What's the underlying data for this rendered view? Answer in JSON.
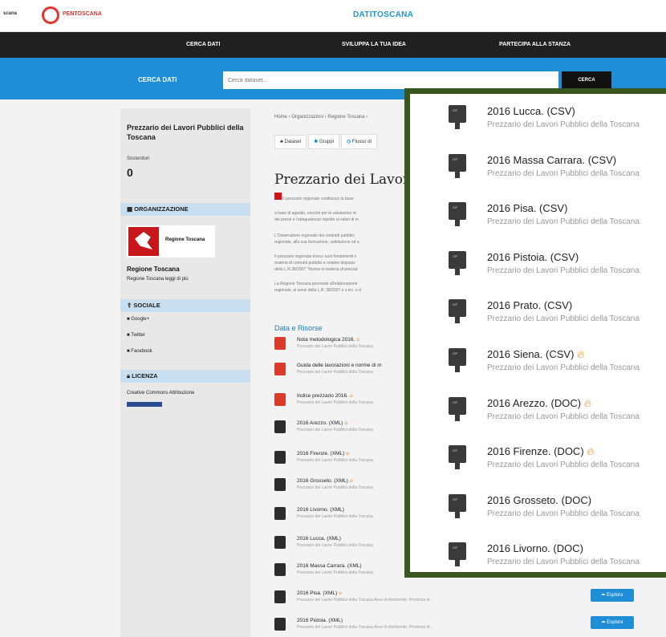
{
  "header": {
    "left_fragment": "scana",
    "logo_text": "PENTOSCANA",
    "site_title": "DATITOSCANA"
  },
  "nav": {
    "items": [
      "CERCA DATI",
      "SVILUPPA LA TUA IDEA",
      "PARTECIPA ALLA STANZA"
    ]
  },
  "search": {
    "label": "CERCA DATI",
    "placeholder": "Cerca dataset...",
    "button": "CERCA"
  },
  "sidebar": {
    "org_title": "Prezzario dei Lavori Pubblici della Toscana",
    "followers_label": "Sostenitori",
    "followers_count": "0",
    "org_section": "ORGANIZZAZIONE",
    "org_logo_text": "Regione Toscana",
    "org_name": "Regione Toscana",
    "org_link": "Regione Toscana leggi di più",
    "social_section": "SOCIALE",
    "social": [
      "Google+",
      "Twitter",
      "Facebook"
    ],
    "license_section": "LICENZA",
    "license_text": "Creative Commons Attribuzione"
  },
  "main": {
    "breadcrumb": "Home › Organizzazioni › Regione Toscana ›",
    "tabs": [
      "Dataset",
      "Gruppi",
      "Flusso di"
    ],
    "title": "Prezzario dei Lavori",
    "paragraphs": [
      "Il prezzario regionale costituisce la base",
      "a base di appalto, nonché per le valutazioni re",
      "dei prezzi e l'adeguatezza rispetto ai valori di m",
      "L'Osservatorio regionale dei contratti pubblici",
      "regionale, alla sua formazione, validazione ed a",
      "Il prezzario regionale trova i suoi fondamenti n",
      "materia di contratti pubblici e relative disposiz",
      "della L.R.38/2007 \"Norme in materia di prezzar",
      "La Regione Toscana provvede all'elaborazione",
      "regionale, ai sensi della L.R. 38/2007 e s.m.i. e d"
    ],
    "resources_heading": "Data e Risorse",
    "resources": [
      {
        "title": "Nota metodologica 2016.",
        "desc": "Prezzario dei Lavori Pubblici della Toscana",
        "type": "pdf",
        "hot": true
      },
      {
        "title": "Guida delle lavorazioni e norme di m",
        "desc": "Prezzario dei Lavori Pubblici della Toscana",
        "type": "pdf",
        "hot": false
      },
      {
        "title": "Indice prezzario 2016.",
        "desc": "Prezzario dei Lavori Pubblici della Toscana",
        "type": "pdf",
        "hot": true
      },
      {
        "title": "2016 Arezzo. (XML)",
        "desc": "Prezzario dei Lavori Pubblici della Toscana",
        "type": "zip",
        "hot": true
      },
      {
        "title": "2016 Firenze. (XML)",
        "desc": "Prezzario dei Lavori Pubblici della Toscana",
        "type": "zip",
        "hot": true
      },
      {
        "title": "2016 Grosseto. (XML)",
        "desc": "Prezzario dei Lavori Pubblici della Toscana",
        "type": "zip",
        "hot": true
      },
      {
        "title": "2016 Livorno. (XML)",
        "desc": "Prezzario dei Lavori Pubblici della Toscana",
        "type": "zip",
        "hot": false
      },
      {
        "title": "2016 Lucca. (XML)",
        "desc": "Prezzario dei Lavori Pubblici della Toscana",
        "type": "zip",
        "hot": false
      },
      {
        "title": "2016 Massa Carrara. (XML)",
        "desc": "Prezzario dei Lavori Pubblici della Toscana",
        "type": "zip",
        "hot": false
      },
      {
        "title": "2016 Pisa. (XML)",
        "desc": "Prezzario dei Lavori Pubblici della Toscana Area di riferimento: Provincia di...",
        "type": "zip",
        "hot": true
      },
      {
        "title": "2016 Pistoia. (XML)",
        "desc": "Prezzario dei Lavori Pubblici della Toscana Area di riferimento: Provincia di...",
        "type": "zip",
        "hot": false
      }
    ],
    "explore_label": "Esplora"
  },
  "zoom": {
    "items": [
      {
        "title": "2016 Lucca. (CSV)",
        "desc": "Prezzario dei Lavori Pubblici della Toscana",
        "hot": false
      },
      {
        "title": "2016 Massa Carrara. (CSV)",
        "desc": "Prezzario dei Lavori Pubblici della Toscana",
        "hot": false
      },
      {
        "title": "2016 Pisa. (CSV)",
        "desc": "Prezzario dei Lavori Pubblici della Toscana",
        "hot": false
      },
      {
        "title": "2016 Pistoia. (CSV)",
        "desc": "Prezzario dei Lavori Pubblici della Toscana",
        "hot": false
      },
      {
        "title": "2016 Prato. (CSV)",
        "desc": "Prezzario dei Lavori Pubblici della Toscana",
        "hot": false
      },
      {
        "title": "2016 Siena. (CSV)",
        "desc": "Prezzario dei Lavori Pubblici della Toscana",
        "hot": true
      },
      {
        "title": "2016 Arezzo. (DOC)",
        "desc": "Prezzario dei Lavori Pubblici della Toscana",
        "hot": true
      },
      {
        "title": "2016 Firenze. (DOC)",
        "desc": "Prezzario dei Lavori Pubblici della Toscana",
        "hot": true
      },
      {
        "title": "2016 Grosseto. (DOC)",
        "desc": "Prezzario dei Lavori Pubblici della Toscana",
        "hot": false
      },
      {
        "title": "2016 Livorno. (DOC)",
        "desc": "Prezzario dei Lavori Pubblici della Toscana",
        "hot": false
      }
    ]
  },
  "colors": {
    "brand_blue": "#1f8ed6",
    "nav_black": "#202020",
    "zoom_border": "#3a5620",
    "logo_red": "#e3342f"
  }
}
